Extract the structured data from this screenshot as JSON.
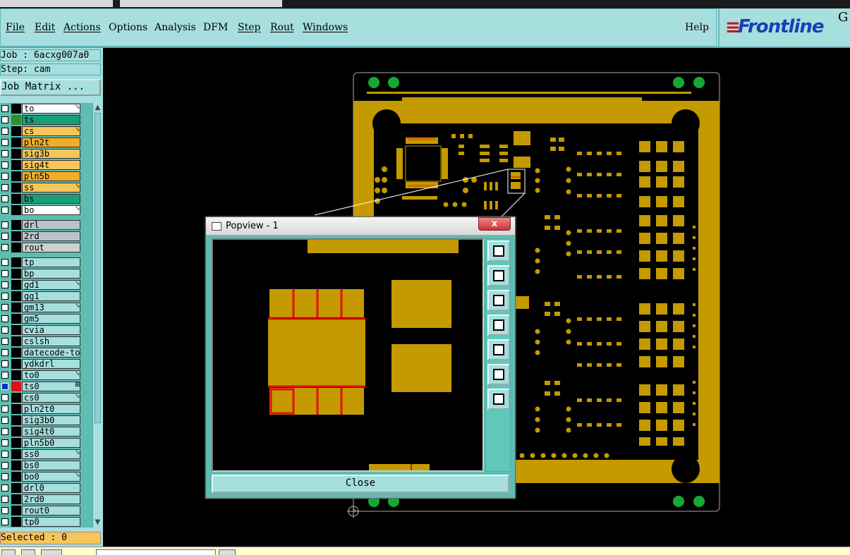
{
  "menu": {
    "file": "File",
    "edit": "Edit",
    "actions": "Actions",
    "options": "Options",
    "analysis": "Analysis",
    "dfm": "DFM",
    "step": "Step",
    "rout": "Rout",
    "windows": "Windows",
    "help": "Help"
  },
  "logo": {
    "mark": "≡",
    "word": "Frontline",
    "suffix": "G"
  },
  "job": {
    "job_line": "Job : 6acxg007a0",
    "step_line": "Step: cam",
    "matrix_button": "Job Matrix ..."
  },
  "layers": [
    {
      "name": "to",
      "color": "#ffffff",
      "swatch": "#000000",
      "mark": "↘"
    },
    {
      "name": "ts",
      "color": "#1a9e78",
      "swatch": "#2f8f2f",
      "mark": ""
    },
    {
      "name": "cs",
      "color": "#f7c55a",
      "swatch": "#000000",
      "mark": "↘"
    },
    {
      "name": "pln2t",
      "color": "#f2ad28",
      "swatch": "#000000",
      "mark": ""
    },
    {
      "name": "sig3b",
      "color": "#f7c55a",
      "swatch": "#000000",
      "mark": ""
    },
    {
      "name": "sig4t",
      "color": "#f7c55a",
      "swatch": "#000000",
      "mark": ""
    },
    {
      "name": "pln5b",
      "color": "#f2ad28",
      "swatch": "#000000",
      "mark": ""
    },
    {
      "name": "ss",
      "color": "#f7c55a",
      "swatch": "#000000",
      "mark": "↘"
    },
    {
      "name": "bs",
      "color": "#1a9e78",
      "swatch": "#000000",
      "mark": ""
    },
    {
      "name": "bo",
      "color": "#ffffff",
      "swatch": "#000000",
      "mark": "↘"
    },
    {
      "name": "drl",
      "color": "#b8c4c8",
      "swatch": "#000000",
      "mark": ""
    },
    {
      "name": "2rd",
      "color": "#b8c4c8",
      "swatch": "#000000",
      "mark": ""
    },
    {
      "name": "rout",
      "color": "#d0d0d0",
      "swatch": "#000000",
      "mark": ""
    },
    {
      "name": "tp",
      "color": "#a7dede",
      "swatch": "#000000",
      "mark": ""
    },
    {
      "name": "bp",
      "color": "#a7dede",
      "swatch": "#000000",
      "mark": ""
    },
    {
      "name": "gd1",
      "color": "#a7dede",
      "swatch": "#000000",
      "mark": "↘"
    },
    {
      "name": "gg1",
      "color": "#a7dede",
      "swatch": "#000000",
      "mark": ""
    },
    {
      "name": "gm13",
      "color": "#a7dede",
      "swatch": "#000000",
      "mark": "↘"
    },
    {
      "name": "gm5",
      "color": "#a7dede",
      "swatch": "#000000",
      "mark": ""
    },
    {
      "name": "cvia",
      "color": "#a7dede",
      "swatch": "#000000",
      "mark": ""
    },
    {
      "name": "cslsh",
      "color": "#a7dede",
      "swatch": "#000000",
      "mark": ""
    },
    {
      "name": "datecode-to",
      "color": "#a7dede",
      "swatch": "#000000",
      "mark": ""
    },
    {
      "name": "ydkdrl",
      "color": "#a7dede",
      "swatch": "#000000",
      "mark": ""
    },
    {
      "name": "to0",
      "color": "#a7dede",
      "swatch": "#000000",
      "mark": "↘"
    },
    {
      "name": "ts0",
      "color": "#a7dede",
      "swatch": "#e01010",
      "mark": "⊞"
    },
    {
      "name": "cs0",
      "color": "#a7dede",
      "swatch": "#000000",
      "mark": "↘"
    },
    {
      "name": "pln2t0",
      "color": "#a7dede",
      "swatch": "#000000",
      "mark": ""
    },
    {
      "name": "sig3b0",
      "color": "#a7dede",
      "swatch": "#000000",
      "mark": ""
    },
    {
      "name": "sig4t0",
      "color": "#a7dede",
      "swatch": "#000000",
      "mark": ""
    },
    {
      "name": "pln5b0",
      "color": "#a7dede",
      "swatch": "#000000",
      "mark": ""
    },
    {
      "name": "ss0",
      "color": "#a7dede",
      "swatch": "#000000",
      "mark": "↘"
    },
    {
      "name": "bs0",
      "color": "#a7dede",
      "swatch": "#000000",
      "mark": ""
    },
    {
      "name": "bo0",
      "color": "#a7dede",
      "swatch": "#000000",
      "mark": "↘"
    },
    {
      "name": "drl0",
      "color": "#a7dede",
      "swatch": "#000000",
      "mark": ""
    },
    {
      "name": "2rd0",
      "color": "#a7dede",
      "swatch": "#000000",
      "mark": ""
    },
    {
      "name": "rout0",
      "color": "#a7dede",
      "swatch": "#000000",
      "mark": ""
    },
    {
      "name": "tp0",
      "color": "#a7dede",
      "swatch": "#000000",
      "mark": ""
    }
  ],
  "selected": "Selected : 0",
  "popview": {
    "title": "Popview - 1",
    "close_x": "x",
    "close_button": "Close",
    "tools": [
      "zoom-fit-icon",
      "pan-up-icon",
      "pan-down-icon",
      "pan-left-icon",
      "pan-right-icon",
      "zoom-in-icon",
      "zoom-out-icon"
    ]
  },
  "colors": {
    "accent": "#a7dede",
    "pad": "#c49a00",
    "highlight": "#e01010",
    "selected": "#f7c55a"
  }
}
